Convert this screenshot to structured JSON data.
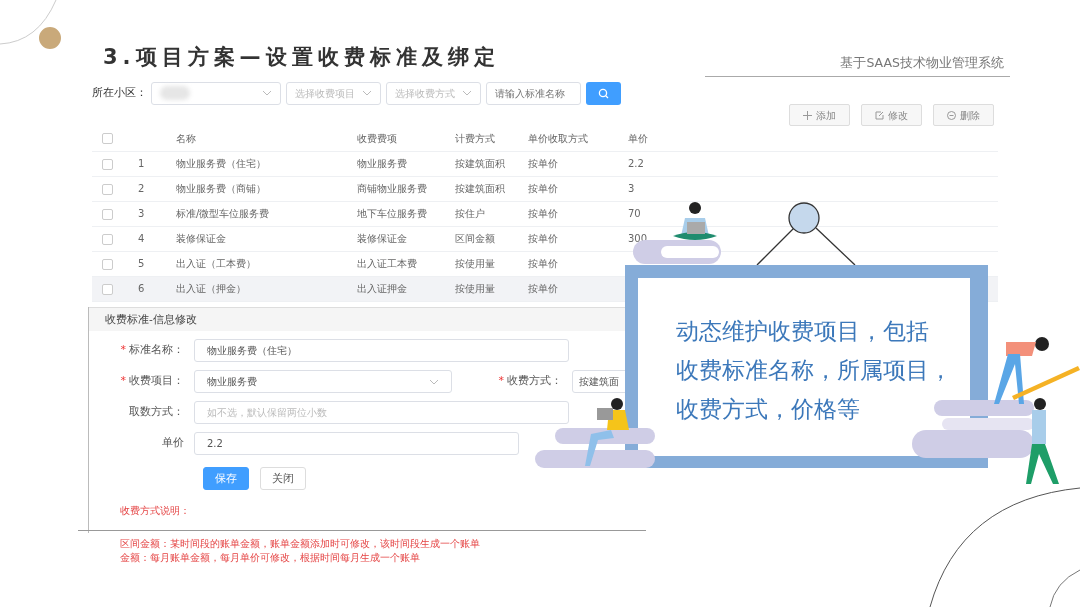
{
  "slide": {
    "title": "3.项目方案—设置收费标准及绑定",
    "subtitle": "基于SAAS技术物业管理系统"
  },
  "filter_bar": {
    "label": "所在小区：",
    "community_select": {
      "redacted": true
    },
    "filters": [
      {
        "kind": "select",
        "placeholder": "选择收费项目"
      },
      {
        "kind": "select",
        "placeholder": "选择收费方式"
      },
      {
        "kind": "input",
        "placeholder": "请输入标准名称"
      }
    ]
  },
  "actions": [
    {
      "kind": "add",
      "label": "添加"
    },
    {
      "kind": "edit",
      "label": "修改"
    },
    {
      "kind": "delete",
      "label": "删除"
    }
  ],
  "table": {
    "header_checked": false,
    "columns": [
      "名称",
      "收费费项",
      "计费方式",
      "单价收取方式",
      "单价"
    ],
    "rows": [
      {
        "index": "1",
        "cells": [
          "物业服务费（住宅）",
          "物业服务费",
          "按建筑面积",
          "按单价",
          "2.2"
        ],
        "checked": false,
        "selected": false
      },
      {
        "index": "2",
        "cells": [
          "物业服务费（商铺）",
          "商铺物业服务费",
          "按建筑面积",
          "按单价",
          "3"
        ],
        "checked": false,
        "selected": false
      },
      {
        "index": "3",
        "cells": [
          "标准/微型车位服务费",
          "地下车位服务费",
          "按住户",
          "按单价",
          "70"
        ],
        "checked": false,
        "selected": false
      },
      {
        "index": "4",
        "cells": [
          "装修保证金",
          "装修保证金",
          "区间金额",
          "按单价",
          "300"
        ],
        "checked": false,
        "selected": false
      },
      {
        "index": "5",
        "cells": [
          "出入证（工本费）",
          "出入证工本费",
          "按使用量",
          "按单价"
        ],
        "checked": false,
        "selected": false
      },
      {
        "index": "6",
        "cells": [
          "出入证（押金）",
          "出入证押金",
          "按使用量",
          "按单价"
        ],
        "checked": false,
        "selected": true
      }
    ]
  },
  "form": {
    "title": "收费标准-信息修改",
    "rows": [
      {
        "fields": [
          {
            "kind": "text",
            "required_mark": "*",
            "label": "标准名称：",
            "value": "物业服务费（住宅）"
          }
        ]
      },
      {
        "fields": [
          {
            "kind": "select",
            "required_mark": "*",
            "label": "收费项目：",
            "value": "物业服务费"
          },
          {
            "kind": "select",
            "required_mark": "*",
            "label": "收费方式：",
            "value": "按建筑面"
          }
        ]
      },
      {
        "fields": [
          {
            "kind": "text",
            "label": "取数方式：",
            "placeholder": "如不选，默认保留两位小数"
          }
        ]
      },
      {
        "fields": [
          {
            "kind": "text",
            "label": "单价",
            "value": "2.2"
          }
        ]
      }
    ],
    "buttons": [
      {
        "label": "保存",
        "primary": true
      },
      {
        "label": "关闭",
        "primary": false
      }
    ],
    "notes": {
      "title": "收费方式说明：",
      "lines": [
        "区间金额：某时间段的账单金额，账单金额添加时可修改，该时间段生成一个账单",
        "金额：每月账单金额，每月单价可修改，根据时间每月生成一个账单"
      ]
    }
  },
  "callout": {
    "lines": [
      "动态维护收费项目，包括",
      "收费标准名称，所属项目，",
      "收费方式，价格等"
    ]
  }
}
